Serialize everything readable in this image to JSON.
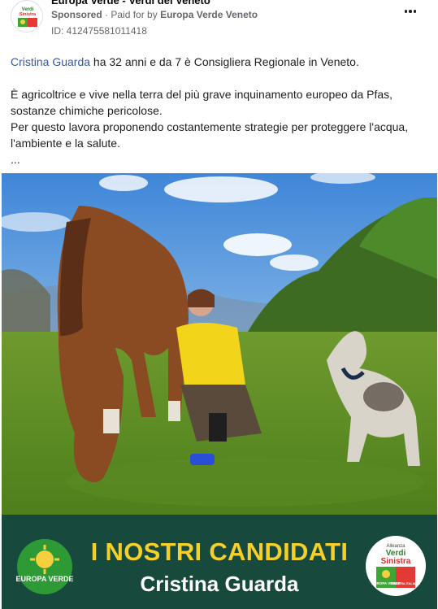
{
  "post": {
    "page_name": "Europa Verde - Verdi del Veneto",
    "sponsored_label": "Sponsored",
    "paid_for_prefix": "· Paid for by",
    "paid_for_name": "Europa Verde Veneto",
    "ad_id": "ID: 412475581011418"
  },
  "text": {
    "mention": "Cristina Guarda",
    "line1_rest": " ha 32 anni e da 7 è Consigliera Regionale in Veneto.",
    "para2_line1": "È agricoltrice e vive nella terra del più grave inquinamento europeo da Pfas,",
    "para2_line2": "sostanze chimiche pericolose.",
    "para2_line3": "Per questo lavora proponendo costantemente strategie per proteggere l'acqua,",
    "para2_line4": "l'ambiente e la salute.",
    "ellipsis": "..."
  },
  "banner": {
    "title": "I NOSTRI CANDIDATI",
    "candidate_name": "Cristina Guarda",
    "logo_left_text": "EUROPA VERDE",
    "logo_right_top": "Alleanza",
    "logo_right_main1": "Verdi",
    "logo_right_main2": "Sinistra",
    "logo_right_small1": "EUROPA VERDE",
    "logo_right_small2": "SINISTRA ITALIANA",
    "avatar_text1": "Verdi",
    "avatar_text2": "Sinistra"
  },
  "icons": {
    "more": "more-options-icon",
    "avatar": "party-logo-avatar"
  },
  "colors": {
    "mention": "#385898",
    "banner_bg": "#174a3c",
    "banner_title": "#f5cf2a",
    "europa_verde_green": "#2e9a36"
  }
}
